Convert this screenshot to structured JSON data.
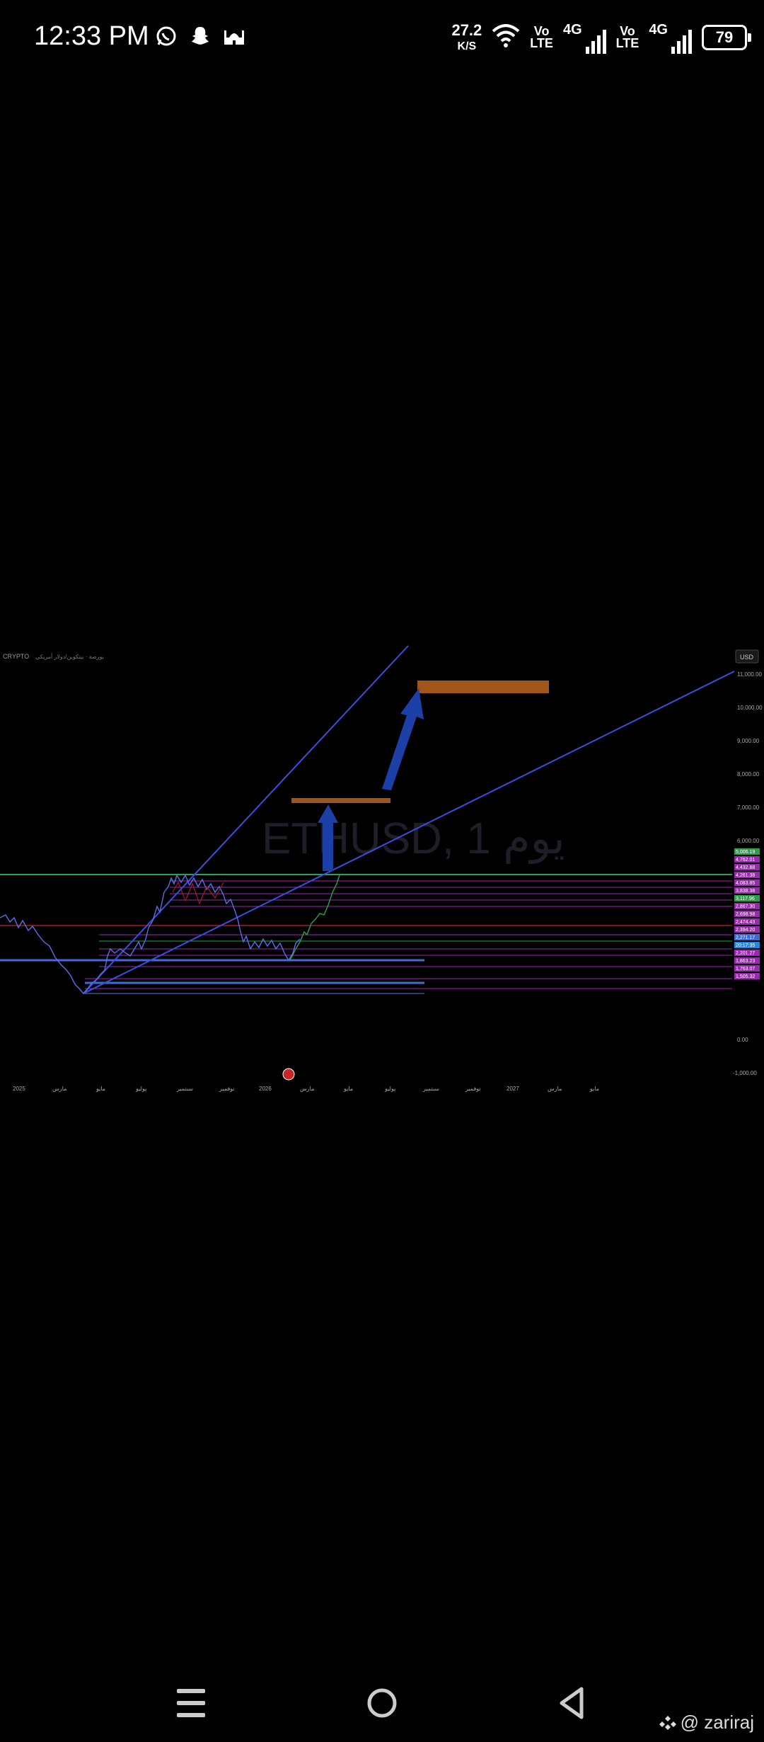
{
  "status_bar": {
    "time": "12:33 PM",
    "speed_value": "27.2",
    "speed_unit": "K/S",
    "sim1_volte_top": "Vo",
    "sim1_volte_bottom": "LTE",
    "sim1_network": "4G",
    "sim2_volte_top": "Vo",
    "sim2_volte_bottom": "LTE",
    "sim2_network": "4G",
    "battery_level": "79",
    "notification_icons": [
      "whatsapp-icon",
      "snapchat-icon",
      "mosque-icon"
    ]
  },
  "chart": {
    "header_label": "CRYPTO",
    "header_text": "بورصة · بيتكوين/دولار أمريكي",
    "watermark_title": "ETHUSD, 1 يوم",
    "currency_button": "USD",
    "y_ticks": [
      "11,000.00",
      "10,000.00",
      "9,000.00",
      "8,000.00",
      "7,000.00",
      "6,000.00",
      "0.00",
      "-1,000.00"
    ],
    "price_labels": [
      {
        "text": "5,006.19",
        "color": "#2e9e4e"
      },
      {
        "text": "4,762.01",
        "color": "#9c27b0"
      },
      {
        "text": "4,432.88",
        "color": "#9c27b0"
      },
      {
        "text": "4,261.38",
        "color": "#9c27b0"
      },
      {
        "text": "4,083.85",
        "color": "#9c27b0"
      },
      {
        "text": "3,838.38",
        "color": "#9c27b0"
      },
      {
        "text": "3,117.96",
        "color": "#2e9e4e"
      },
      {
        "text": "2,867.30",
        "color": "#9c27b0"
      },
      {
        "text": "2,698.98",
        "color": "#9c27b0"
      },
      {
        "text": "2,474.43",
        "color": "#9c27b0"
      },
      {
        "text": "2,394.20",
        "color": "#9c27b0"
      },
      {
        "text": "2,271.17",
        "color": "#3f6ad8"
      },
      {
        "text": "20:17:35",
        "color": "#1e88e5"
      },
      {
        "text": "2,201.27",
        "color": "#9c27b0"
      },
      {
        "text": "1,863.23",
        "color": "#9c27b0"
      },
      {
        "text": "1,763.07",
        "color": "#9c27b0"
      },
      {
        "text": "1,505.32",
        "color": "#9c27b0"
      }
    ],
    "x_labels": [
      "2025",
      "مارس",
      "مايو",
      "يوليو",
      "سبتمبر",
      "نوفمبر",
      "2026",
      "مارس",
      "مايو",
      "يوليو",
      "سبتمبر",
      "نوفمبر",
      "2027",
      "مارس",
      "مايو"
    ],
    "colors": {
      "trendline": "#3c4ee0",
      "price_line": "#5a6fe8",
      "target_box": "#a0561a",
      "arrow": "#1d3fa8",
      "support_green": "#29a34a",
      "level_purple": "#9c27b0",
      "level_red": "#a31c2a"
    }
  },
  "nav": {
    "menu_icon": "menu-icon",
    "home_icon": "home-icon",
    "back_icon": "back-icon"
  },
  "watermark": {
    "text": "@ zariraj"
  }
}
